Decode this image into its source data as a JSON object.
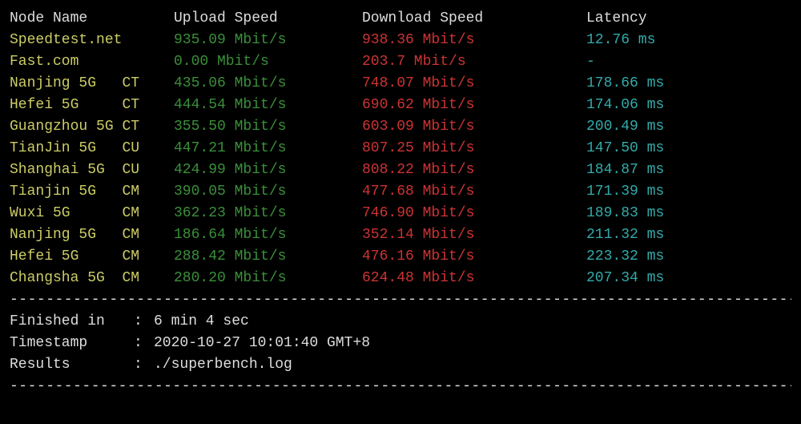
{
  "headers": {
    "node": "Node Name",
    "upload": "Upload Speed",
    "download": "Download Speed",
    "latency": "Latency"
  },
  "rows": [
    {
      "name": "Speedtest.net",
      "carrier": "",
      "upload": "935.09 Mbit/s",
      "download": "938.36 Mbit/s",
      "latency": "12.76 ms"
    },
    {
      "name": "Fast.com",
      "carrier": "",
      "upload": "0.00 Mbit/s",
      "download": "203.7 Mbit/s",
      "latency": "-"
    },
    {
      "name": "Nanjing 5G",
      "carrier": "CT",
      "upload": "435.06 Mbit/s",
      "download": "748.07 Mbit/s",
      "latency": "178.66 ms"
    },
    {
      "name": "Hefei 5G",
      "carrier": "CT",
      "upload": "444.54 Mbit/s",
      "download": "690.62 Mbit/s",
      "latency": "174.06 ms"
    },
    {
      "name": "Guangzhou 5G",
      "carrier": "CT",
      "upload": "355.50 Mbit/s",
      "download": "603.09 Mbit/s",
      "latency": "200.49 ms"
    },
    {
      "name": "TianJin 5G",
      "carrier": "CU",
      "upload": "447.21 Mbit/s",
      "download": "807.25 Mbit/s",
      "latency": "147.50 ms"
    },
    {
      "name": "Shanghai 5G",
      "carrier": "CU",
      "upload": "424.99 Mbit/s",
      "download": "808.22 Mbit/s",
      "latency": "184.87 ms"
    },
    {
      "name": "Tianjin 5G",
      "carrier": "CM",
      "upload": "390.05 Mbit/s",
      "download": "477.68 Mbit/s",
      "latency": "171.39 ms"
    },
    {
      "name": "Wuxi 5G",
      "carrier": "CM",
      "upload": "362.23 Mbit/s",
      "download": "746.90 Mbit/s",
      "latency": "189.83 ms"
    },
    {
      "name": "Nanjing 5G",
      "carrier": "CM",
      "upload": "186.64 Mbit/s",
      "download": "352.14 Mbit/s",
      "latency": "211.32 ms"
    },
    {
      "name": "Hefei 5G",
      "carrier": "CM",
      "upload": "288.42 Mbit/s",
      "download": "476.16 Mbit/s",
      "latency": "223.32 ms"
    },
    {
      "name": "Changsha 5G",
      "carrier": "CM",
      "upload": "280.20 Mbit/s",
      "download": "624.48 Mbit/s",
      "latency": "207.34 ms"
    }
  ],
  "separator": "----------------------------------------------------------------------------------------",
  "footer": {
    "finished_label": "Finished in",
    "finished_value": "6 min 4 sec",
    "timestamp_label": "Timestamp",
    "timestamp_value": "2020-10-27 10:01:40 GMT+8",
    "results_label": "Results",
    "results_value": "./superbench.log",
    "sep": ":"
  }
}
